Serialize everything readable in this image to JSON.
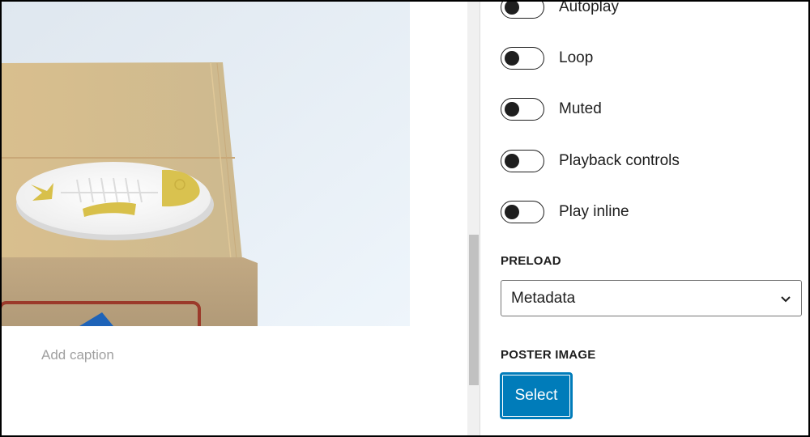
{
  "editor": {
    "image_alt": "Beige box with white fish-bone plate and gold accents",
    "caption_placeholder": "Add caption"
  },
  "sidebar": {
    "toggles": [
      {
        "label": "Autoplay",
        "checked": false
      },
      {
        "label": "Loop",
        "checked": false
      },
      {
        "label": "Muted",
        "checked": false
      },
      {
        "label": "Playback controls",
        "checked": false
      },
      {
        "label": "Play inline",
        "checked": false
      }
    ],
    "preload": {
      "label": "PRELOAD",
      "selected": "Metadata"
    },
    "poster_image": {
      "label": "POSTER IMAGE",
      "button_label": "Select"
    }
  },
  "colors": {
    "accent": "#007cba",
    "text": "#1e1e1e",
    "placeholder": "#a0a0a0"
  }
}
